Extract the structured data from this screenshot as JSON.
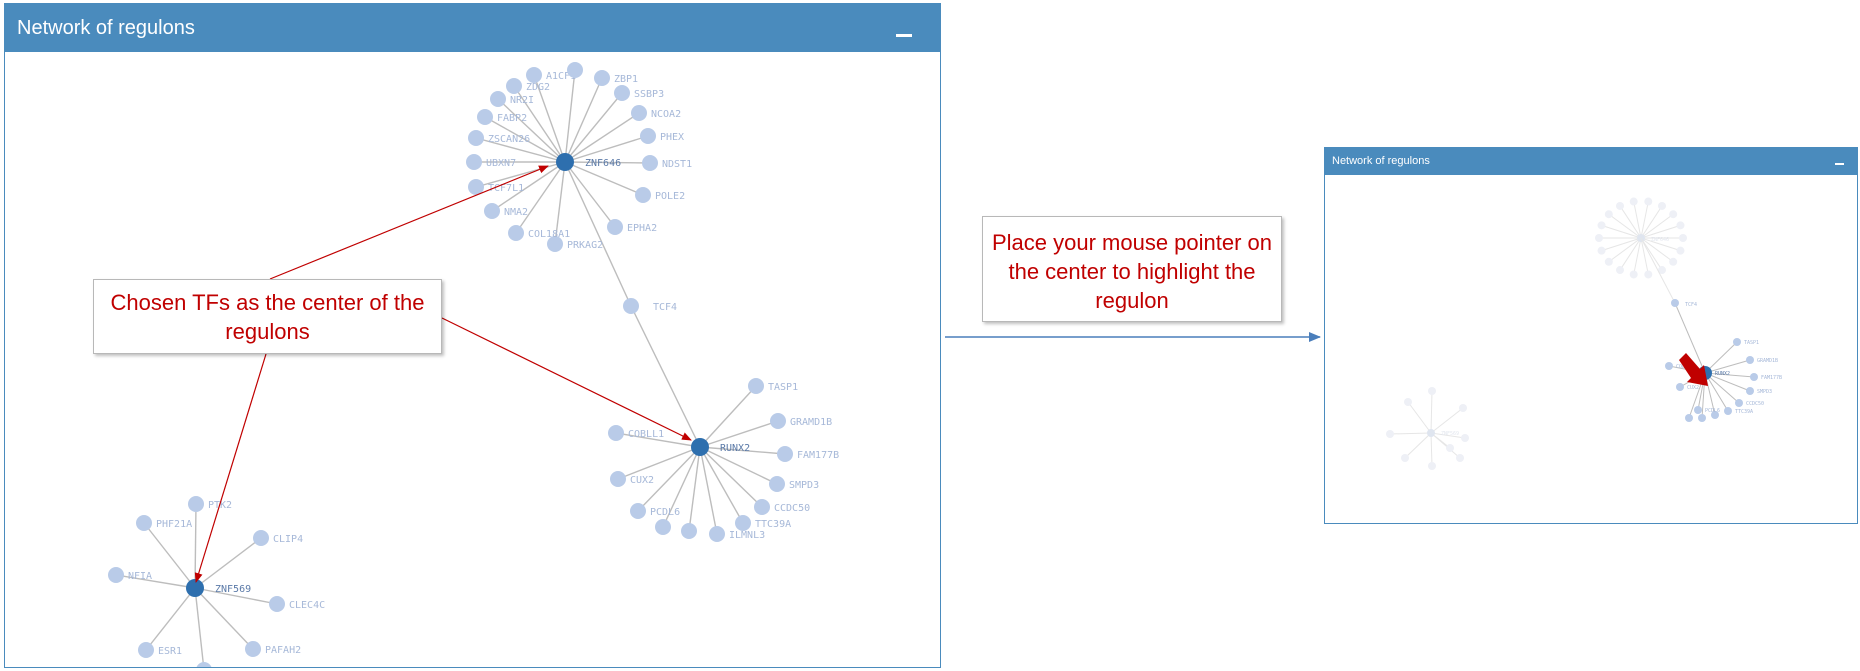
{
  "panel_main": {
    "title": "Network of regulons",
    "minimize_icon": "minus-icon"
  },
  "panel_preview": {
    "title": "Network of regulons",
    "minimize_icon": "minus-icon"
  },
  "callouts": {
    "chosen_tfs": "Chosen TFs  as the center of the regulons",
    "mouse_hint": "Place your mouse pointer on the center to highlight the regulon"
  },
  "colors": {
    "header": "#4a8bbd",
    "center_node": "#2e6fae",
    "leaf_node": "#b9cbe8",
    "edge": "#bdbdbd",
    "annotation": "#c00000",
    "flow_arrow": "#4a7ebb"
  },
  "network_main": {
    "centers": [
      "ZNF646",
      "RUNX2",
      "ZNF569"
    ],
    "linker_nodes": [
      "TCF4"
    ],
    "ZNF646_targets": [
      "ZBP1",
      "SSBP3",
      "NCOA2",
      "PHEX",
      "NDST1",
      "POLE2",
      "EPHA2",
      "PRKAG2",
      "COL18A1",
      "NMA2",
      "TCF7L1",
      "UBXN7",
      "ZSCAN26",
      "FABP2",
      "NR2I",
      "ZDG2",
      "A1CF1"
    ],
    "RUNX2_targets": [
      "TASP1",
      "GRAMD1B",
      "FAM177B",
      "SMPD3",
      "CCDC50",
      "TTC39A",
      "ILMNL3",
      "CUX2",
      "PCDL6",
      "COBLL1"
    ],
    "ZNF569_targets": [
      "PTK2",
      "PHF21A",
      "CLIP4",
      "NFIA",
      "CLEC4C",
      "ESR1",
      "PAFAH2"
    ]
  },
  "network_preview": {
    "labels": [
      "ZNF646",
      "TCF4",
      "RUNX2",
      "TASP1",
      "GRAMD1B",
      "FAM177B",
      "SMPD3",
      "CCDC50",
      "TTC39A",
      "CUX2",
      "PCDL6",
      "COBLL1",
      "ZNF569"
    ]
  }
}
